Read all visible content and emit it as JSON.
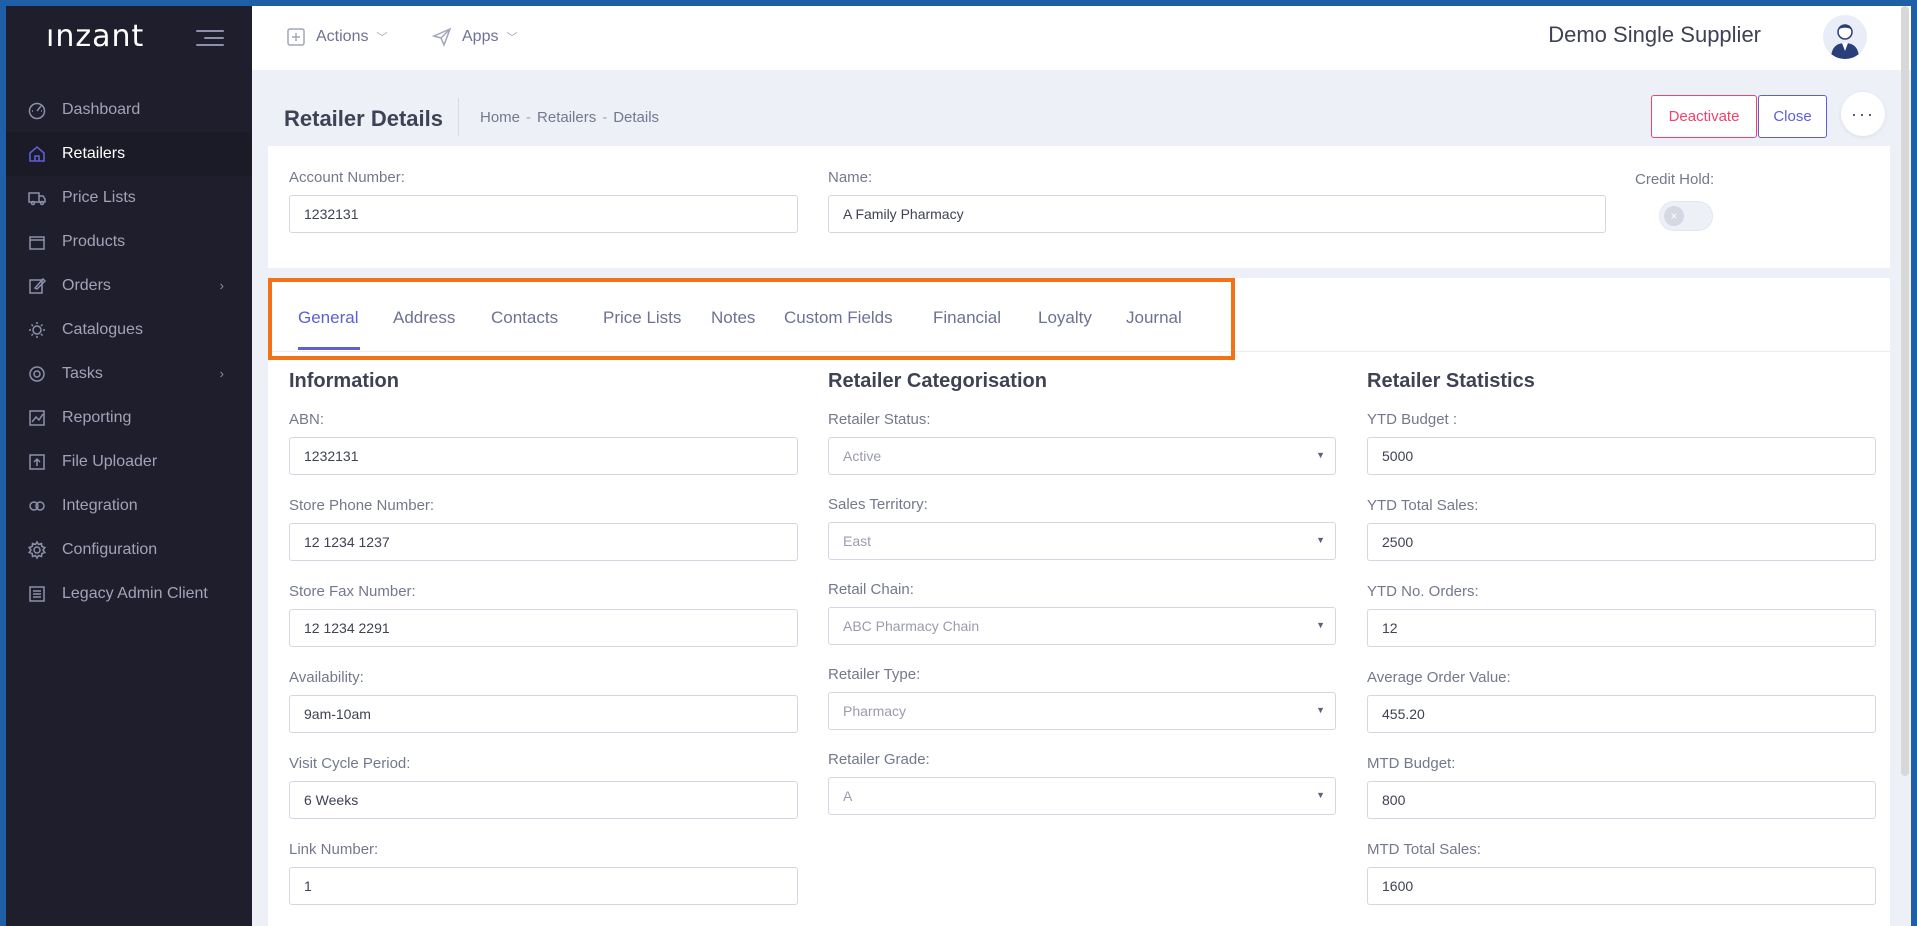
{
  "app": {
    "logo": "ınzant"
  },
  "sidebar": {
    "items": [
      {
        "label": "Dashboard",
        "icon": "dashboard-icon",
        "active": false
      },
      {
        "label": "Retailers",
        "icon": "home-icon",
        "active": true
      },
      {
        "label": "Price Lists",
        "icon": "truck-icon",
        "active": false
      },
      {
        "label": "Products",
        "icon": "box-icon",
        "active": false
      },
      {
        "label": "Orders",
        "icon": "edit-icon",
        "active": false,
        "has_children": true
      },
      {
        "label": "Catalogues",
        "icon": "sun-icon",
        "active": false
      },
      {
        "label": "Tasks",
        "icon": "settings-icon",
        "active": false,
        "has_children": true
      },
      {
        "label": "Reporting",
        "icon": "chart-icon",
        "active": false
      },
      {
        "label": "File Uploader",
        "icon": "upload-icon",
        "active": false
      },
      {
        "label": "Integration",
        "icon": "integration-icon",
        "active": false
      },
      {
        "label": "Configuration",
        "icon": "gear-icon",
        "active": false
      },
      {
        "label": "Legacy Admin Client",
        "icon": "sliders-icon",
        "active": false
      }
    ]
  },
  "topbar": {
    "actions_label": "Actions",
    "apps_label": "Apps",
    "supplier_name": "Demo Single Supplier"
  },
  "subheader": {
    "title": "Retailer Details",
    "breadcrumb": [
      "Home",
      "Retailers",
      "Details"
    ],
    "deactivate_label": "Deactivate",
    "close_label": "Close",
    "more_label": "···"
  },
  "header": {
    "account_number_label": "Account Number:",
    "account_number_value": "1232131",
    "name_label": "Name:",
    "name_value": "A Family Pharmacy",
    "credit_hold_label": "Credit Hold:",
    "credit_hold_on": false
  },
  "tabs": [
    {
      "label": "General",
      "active": true
    },
    {
      "label": "Address"
    },
    {
      "label": "Contacts"
    },
    {
      "label": "Price Lists"
    },
    {
      "label": "Notes"
    },
    {
      "label": "Custom Fields"
    },
    {
      "label": "Financial"
    },
    {
      "label": "Loyalty"
    },
    {
      "label": "Journal"
    }
  ],
  "information": {
    "title": "Information",
    "fields": [
      {
        "label": "ABN:",
        "value": "1232131"
      },
      {
        "label": "Store Phone Number:",
        "value": "12 1234 1237"
      },
      {
        "label": "Store Fax Number:",
        "value": "12 1234 2291"
      },
      {
        "label": "Availability:",
        "value": "9am-10am"
      },
      {
        "label": "Visit Cycle Period:",
        "value": "6 Weeks"
      },
      {
        "label": "Link Number:",
        "value": "1"
      }
    ]
  },
  "categorisation": {
    "title": "Retailer Categorisation",
    "fields": [
      {
        "label": "Retailer Status:",
        "value": "Active"
      },
      {
        "label": "Sales Territory:",
        "value": "East"
      },
      {
        "label": "Retail Chain:",
        "value": "ABC Pharmacy Chain"
      },
      {
        "label": "Retailer Type:",
        "value": "Pharmacy"
      },
      {
        "label": "Retailer Grade:",
        "value": "A"
      }
    ]
  },
  "statistics": {
    "title": "Retailer Statistics",
    "fields": [
      {
        "label": "YTD Budget :",
        "value": "5000"
      },
      {
        "label": "YTD Total Sales:",
        "value": "2500"
      },
      {
        "label": "YTD No. Orders:",
        "value": "12"
      },
      {
        "label": "Average Order Value:",
        "value": "455.20"
      },
      {
        "label": "MTD Budget:",
        "value": "800"
      },
      {
        "label": "MTD Total Sales:",
        "value": "1600"
      }
    ]
  },
  "colors": {
    "accent": "#5d5fd5",
    "danger": "#f1416c",
    "sidebar_bg": "#1e1e2d",
    "highlight": "#f47216"
  }
}
